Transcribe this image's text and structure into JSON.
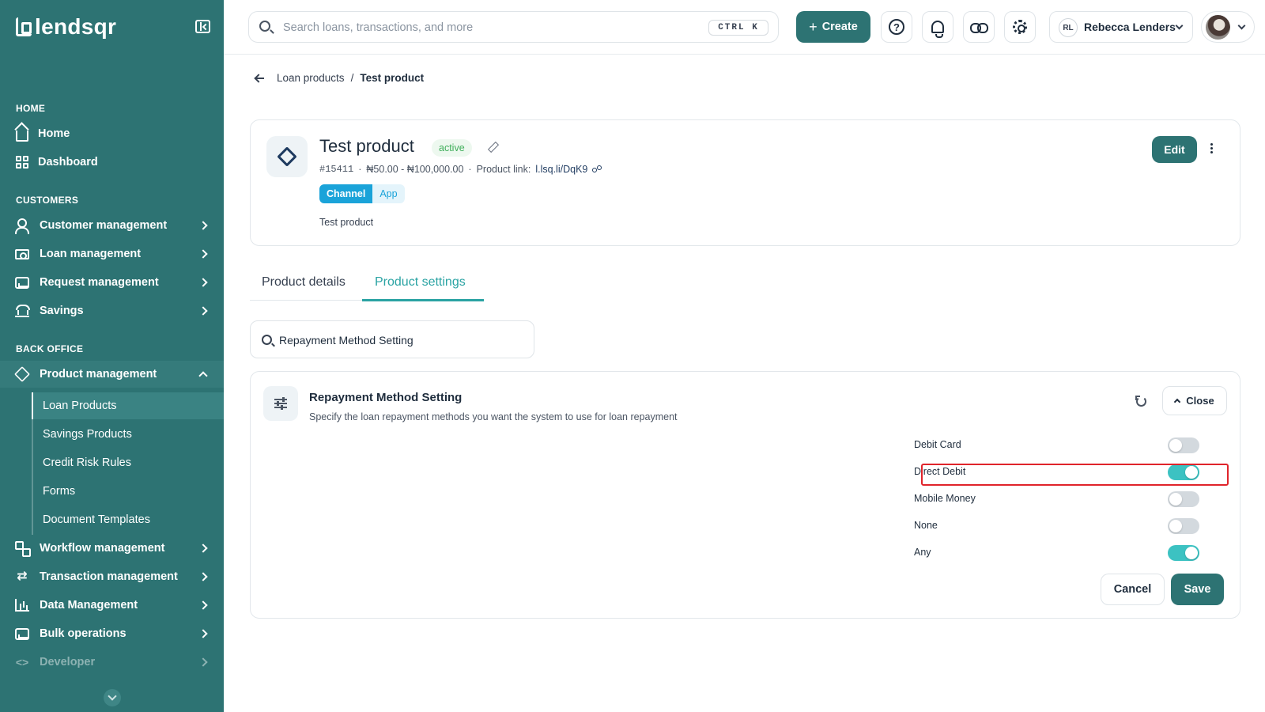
{
  "brand": {
    "name": "lendsqr"
  },
  "sidebar": {
    "sections": {
      "home": "HOME",
      "customers": "CUSTOMERS",
      "back_office": "BACK OFFICE"
    },
    "home_items": [
      "Home",
      "Dashboard"
    ],
    "customer_items": [
      "Customer management",
      "Loan management",
      "Request management",
      "Savings"
    ],
    "product_management": {
      "label": "Product management",
      "children": [
        "Loan Products",
        "Savings Products",
        "Credit Risk Rules",
        "Forms",
        "Document Templates"
      ],
      "active_child": "Loan Products"
    },
    "back_office_items": [
      "Workflow management",
      "Transaction management",
      "Data Management",
      "Bulk operations",
      "Developer"
    ]
  },
  "topbar": {
    "search_placeholder": "Search loans, transactions, and more",
    "shortcut": "CTRL K",
    "create_label": "Create",
    "account_initials": "RL",
    "account_name": "Rebecca Lenders"
  },
  "breadcrumb": {
    "parent": "Loan products",
    "separator": "/",
    "current": "Test product"
  },
  "product": {
    "title": "Test product",
    "status": "active",
    "id": "#15411",
    "amount_range": "₦50.00 - ₦100,000.00",
    "link_label": "Product link:",
    "link": "l.lsq.li/DqK9",
    "channel_label": "Channel",
    "channel_value": "App",
    "description": "Test product",
    "edit_label": "Edit"
  },
  "tabs": [
    {
      "label": "Product details",
      "active": false
    },
    {
      "label": "Product settings",
      "active": true
    }
  ],
  "settings_search": {
    "value": "Repayment Method Setting"
  },
  "setting": {
    "title": "Repayment Method Setting",
    "subtitle": "Specify the loan repayment methods you want the system to use for loan repayment",
    "close_label": "Close",
    "options": [
      {
        "label": "Debit Card",
        "enabled": false
      },
      {
        "label": "Direct Debit",
        "enabled": true
      },
      {
        "label": "Mobile Money",
        "enabled": false
      },
      {
        "label": "None",
        "enabled": false
      },
      {
        "label": "Any",
        "enabled": true
      }
    ],
    "cancel_label": "Cancel",
    "save_label": "Save"
  },
  "colors": {
    "sidebar": "#2d7373",
    "primary": "#2d7373",
    "toggle_on": "#3cc2c2",
    "tab_active": "#2aa3a3",
    "channel_tag": "#1aa3d9",
    "highlight": "#e0242b"
  }
}
